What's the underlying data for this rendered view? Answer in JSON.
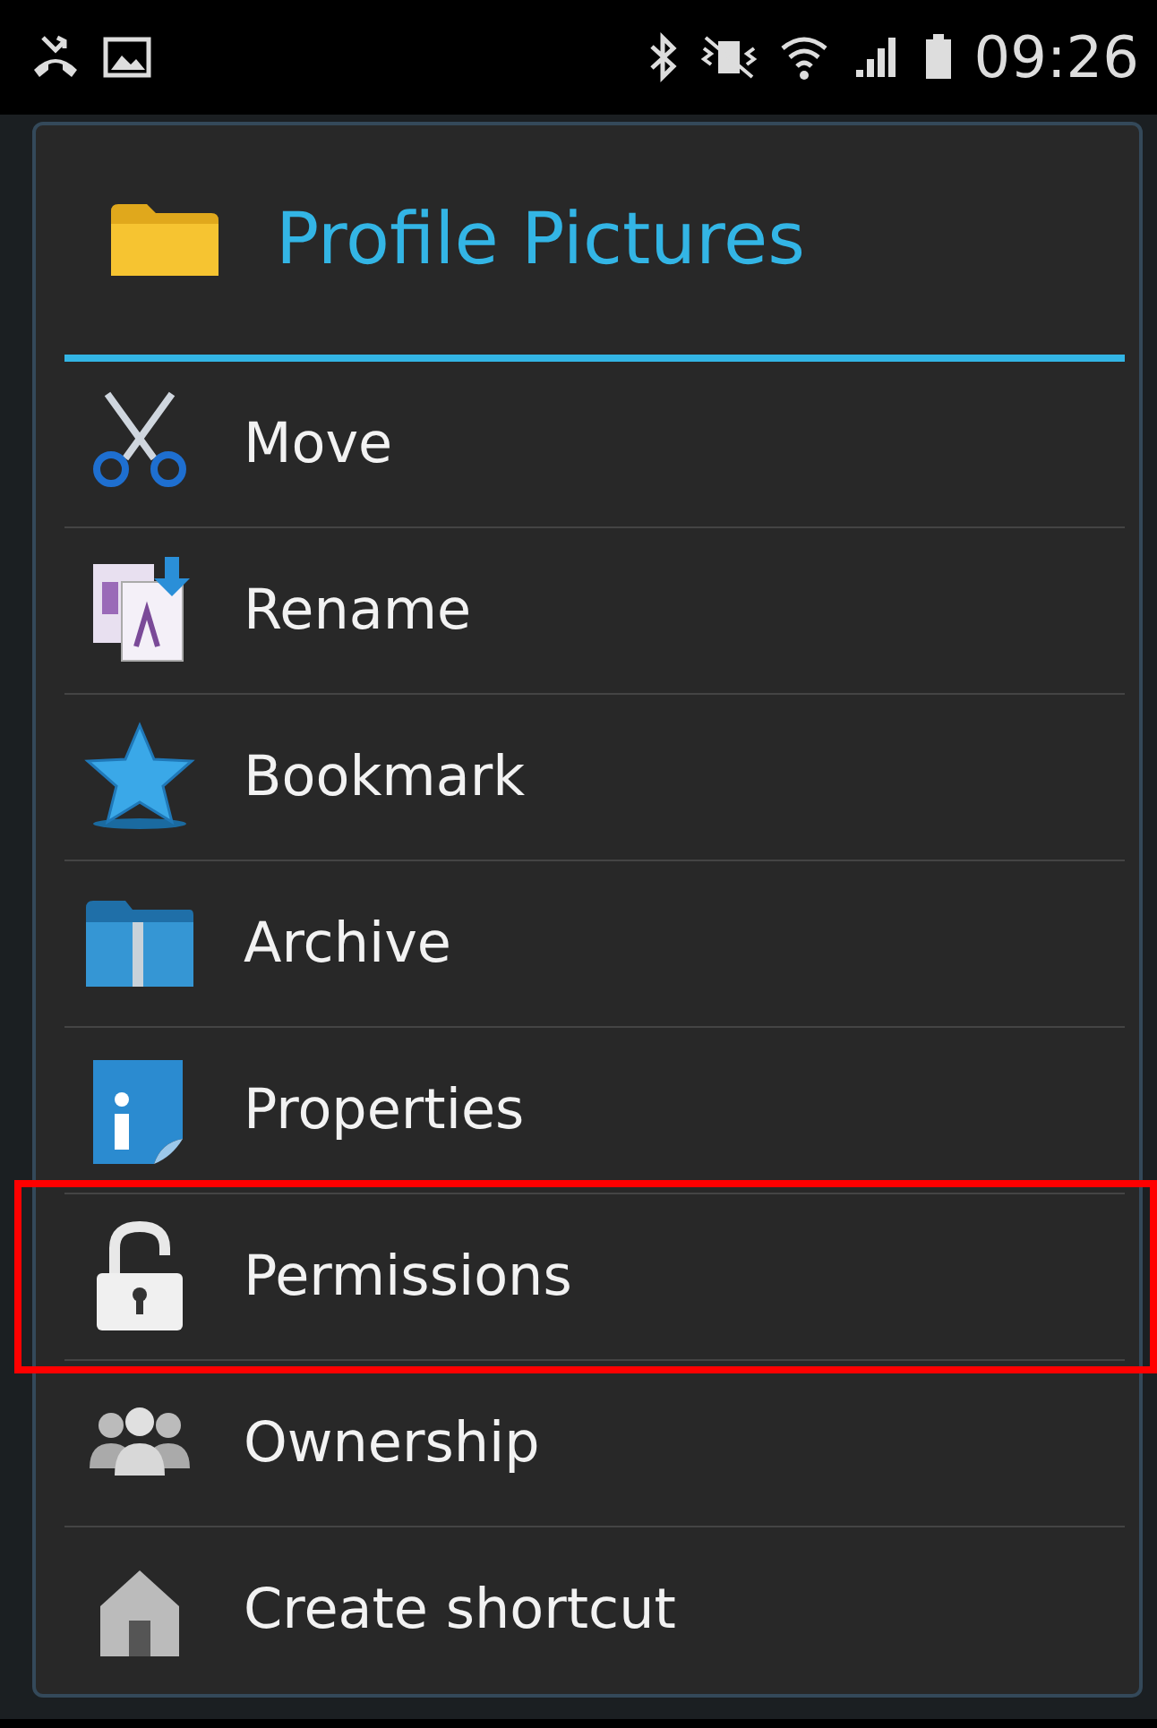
{
  "status_bar": {
    "time": "09:26"
  },
  "dialog": {
    "title": "Profile Pictures",
    "items": [
      {
        "label": "Move",
        "kind": "scissors",
        "highlighted": false
      },
      {
        "label": "Rename",
        "kind": "rename",
        "highlighted": false
      },
      {
        "label": "Bookmark",
        "kind": "star",
        "highlighted": false
      },
      {
        "label": "Archive",
        "kind": "archive",
        "highlighted": false
      },
      {
        "label": "Properties",
        "kind": "info",
        "highlighted": false
      },
      {
        "label": "Permissions",
        "kind": "lock",
        "highlighted": true
      },
      {
        "label": "Ownership",
        "kind": "people",
        "highlighted": false
      },
      {
        "label": "Create shortcut",
        "kind": "shortcut",
        "highlighted": false
      }
    ]
  }
}
